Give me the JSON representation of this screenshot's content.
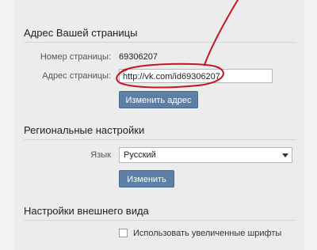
{
  "address_section": {
    "title": "Адрес Вашей страницы",
    "page_number_label": "Номер страницы:",
    "page_number_value": "69306207",
    "page_address_label": "Адрес страницы:",
    "page_address_value": "http://vk.com/id69306207",
    "change_button": "Изменить адрес"
  },
  "regional_section": {
    "title": "Региональные настройки",
    "language_label": "Язык",
    "language_selected": "Русский",
    "change_button": "Изменить"
  },
  "appearance_section": {
    "title": "Настройки внешнего вида",
    "large_fonts_label": "Использовать увеличенные шрифты",
    "large_fonts_checked": false
  },
  "colors": {
    "button": "#5d7fa6",
    "annotation": "#c0191f"
  }
}
